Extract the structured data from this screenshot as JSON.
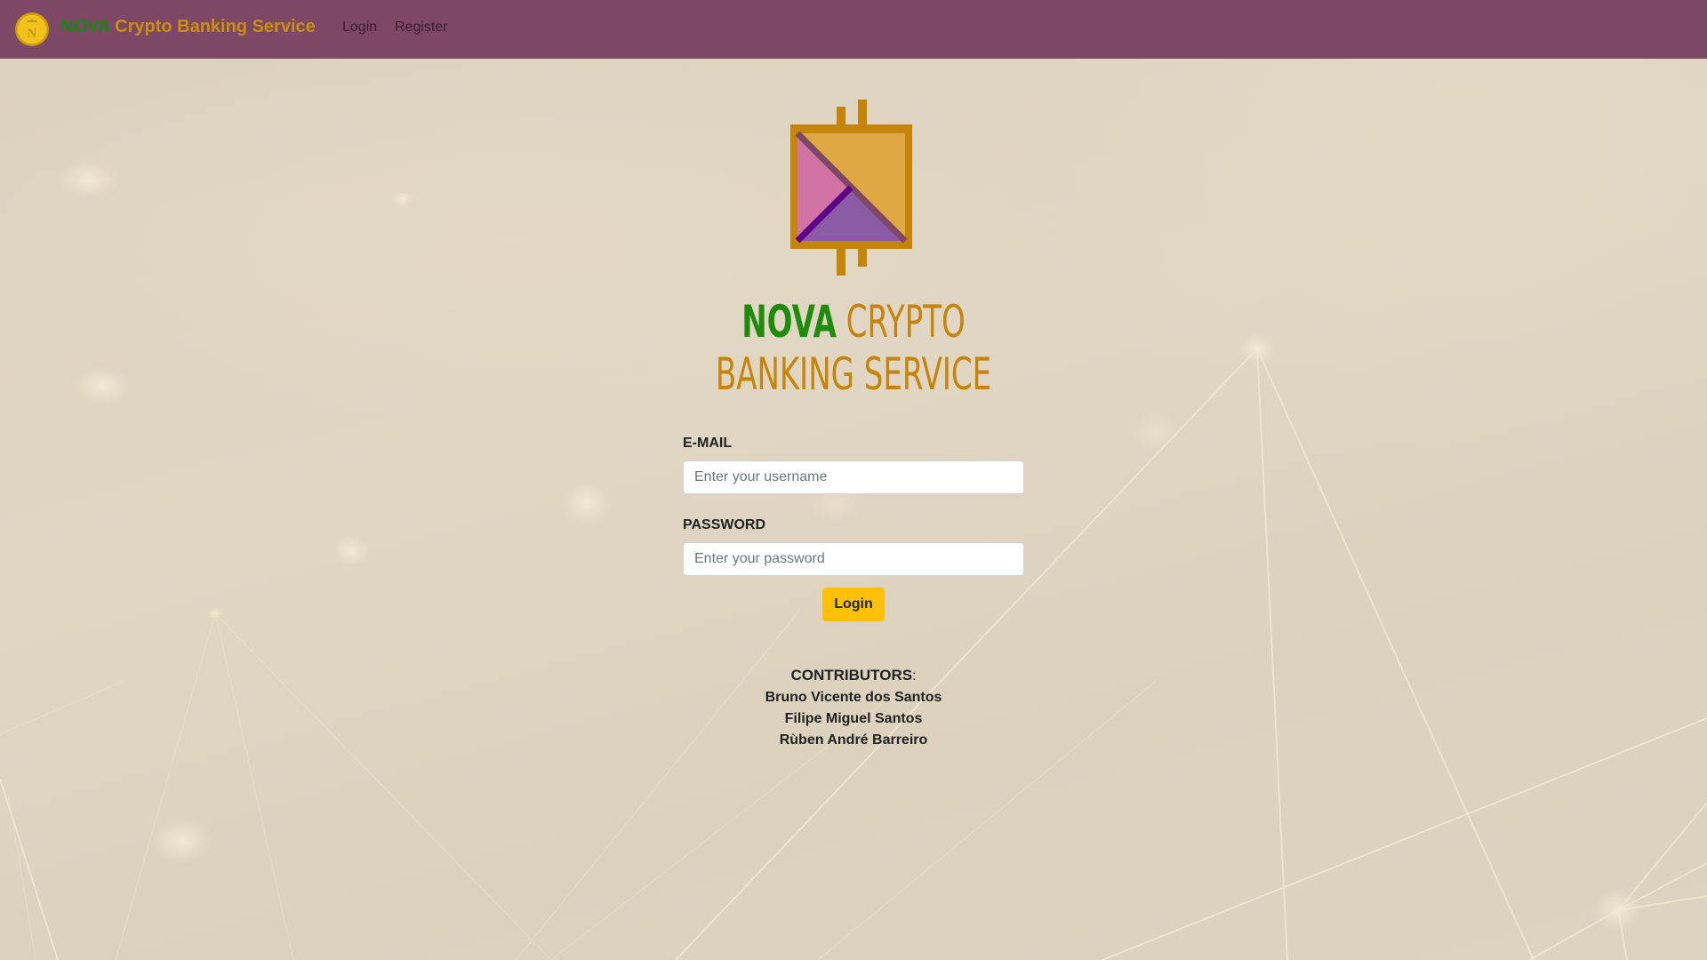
{
  "navbar": {
    "logo_icon": "gold-coin-icon",
    "brand_nova": "NOVA",
    "brand_rest": "Crypto Banking Service",
    "links": [
      {
        "label": "Login"
      },
      {
        "label": "Register"
      }
    ],
    "colors": {
      "background": "#7f4766",
      "nova": "#148a14",
      "brand": "#c8900f"
    }
  },
  "hero": {
    "logo_icon": "nova-crypto-logo-icon",
    "title_line1_nova": "NOVA",
    "title_line1_rest": "CRYPTO",
    "title_line2": "BANKING SERVICE"
  },
  "form": {
    "email_label": "E-MAIL",
    "email_placeholder": "Enter your username",
    "email_value": "",
    "password_label": "PASSWORD",
    "password_placeholder": "Enter your password",
    "password_value": "",
    "submit_label": "Login",
    "submit_color": "#ffc107"
  },
  "contributors": {
    "heading": "CONTRIBUTORS",
    "separator": ":",
    "names": [
      "Bruno Vicente dos Santos",
      "Filipe Miguel Santos",
      "Rùben André Barreiro"
    ]
  }
}
